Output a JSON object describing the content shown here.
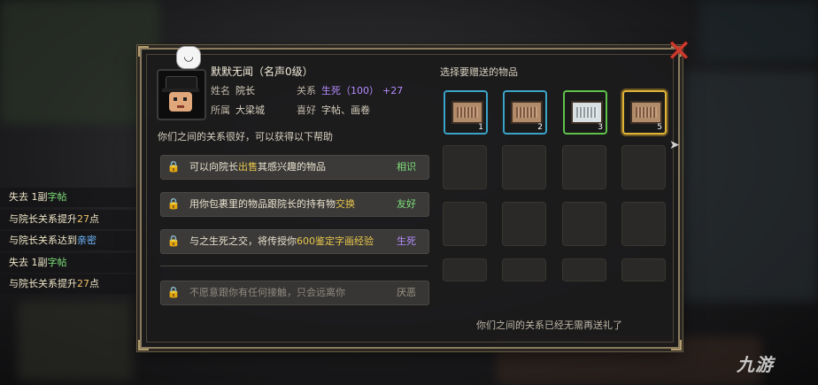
{
  "event_log": [
    {
      "pre": "失去 1副",
      "hl": "字帖",
      "hl_class": "g",
      "post": ""
    },
    {
      "pre": "与院长关系提升",
      "hl": "27",
      "hl_class": "n",
      "post": "点"
    },
    {
      "pre": "与院长关系达到",
      "hl": "亲密",
      "hl_class": "b",
      "post": ""
    },
    {
      "pre": "失去 1副",
      "hl": "字帖",
      "hl_class": "g",
      "post": ""
    },
    {
      "pre": "与院长关系提升",
      "hl": "27",
      "hl_class": "n",
      "post": "点"
    }
  ],
  "npc": {
    "name": "默默无闻（名声0级）",
    "surname_label": "姓名",
    "surname": "院长",
    "relation_label": "关系",
    "relation": "生死（100）",
    "relation_delta": "+27",
    "faction_label": "所属",
    "faction": "大梁城",
    "likes_label": "喜好",
    "likes": "字帖、画卷"
  },
  "help": {
    "title": "你们之间的关系很好，可以获得以下帮助",
    "rows": [
      {
        "pre": "可以向院长",
        "hl": "出售",
        "post": "其感兴趣的物品",
        "tier": "相识",
        "enabled": true
      },
      {
        "pre": "用你包裹里的物品跟院长的持有物",
        "hl": "交换",
        "post": "",
        "tier": "友好",
        "enabled": true
      },
      {
        "pre": "与之生死之交，将传授你",
        "hl": "600鉴定字画经验",
        "post": "",
        "tier": "生死",
        "enabled": true
      },
      {
        "pre": "不愿意跟你有任何接触，只会远离你",
        "hl": "",
        "post": "",
        "tier": "厌恶",
        "enabled": false
      }
    ]
  },
  "gift": {
    "title": "选择要赠送的物品",
    "filled": [
      {
        "count": "1",
        "icon": "calligraphy-scroll-icon",
        "frame_color": "#3aa4c8"
      },
      {
        "count": "2",
        "icon": "calligraphy-scroll-icon",
        "frame_color": "#3aa4c8"
      },
      {
        "count": "3",
        "icon": "painting-scroll-icon",
        "frame_color": "#5ec24a"
      },
      {
        "count": "5",
        "icon": "calligraphy-scroll-icon",
        "frame_color": "#e0b43a"
      }
    ],
    "footer": "你们之间的关系已经无需再送礼了"
  },
  "ui": {
    "close_glyph": "✕",
    "smile_glyph": "◡",
    "lock_glyph": "🔒",
    "cursor_glyph": "➤",
    "watermark": "九游"
  }
}
